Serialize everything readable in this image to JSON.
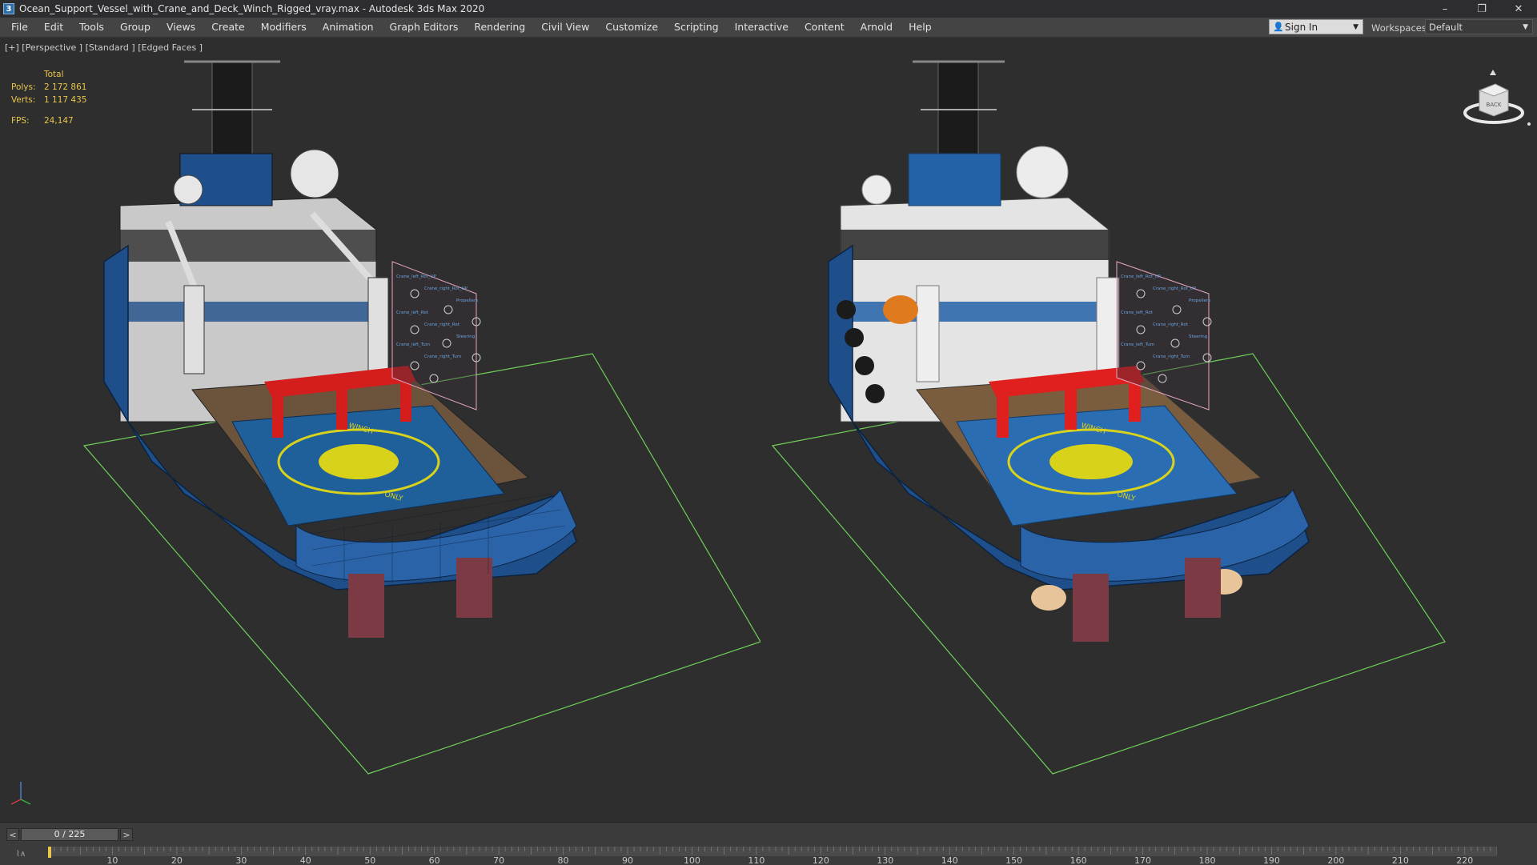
{
  "window": {
    "icon_letter": "3",
    "title": "Ocean_Support_Vessel_with_Crane_and_Deck_Winch_Rigged_vray.max - Autodesk 3ds Max 2020",
    "minimize": "–",
    "restore": "❐",
    "close": "✕"
  },
  "menu": {
    "items": [
      {
        "label": "File"
      },
      {
        "label": "Edit"
      },
      {
        "label": "Tools"
      },
      {
        "label": "Group"
      },
      {
        "label": "Views"
      },
      {
        "label": "Create"
      },
      {
        "label": "Modifiers"
      },
      {
        "label": "Animation"
      },
      {
        "label": "Graph Editors"
      },
      {
        "label": "Rendering"
      },
      {
        "label": "Civil View"
      },
      {
        "label": "Customize"
      },
      {
        "label": "Scripting"
      },
      {
        "label": "Interactive"
      },
      {
        "label": "Content"
      },
      {
        "label": "Arnold"
      },
      {
        "label": "Help"
      }
    ]
  },
  "account": {
    "signin_label": "Sign In"
  },
  "workspaces": {
    "label": "Workspaces:",
    "value": "Default"
  },
  "viewport": {
    "label": "[+] [Perspective ] [Standard ] [Edged Faces ]",
    "stats": {
      "total_label": "Total",
      "polys_label": "Polys:",
      "polys_value": "2 172 861",
      "verts_label": "Verts:",
      "verts_value": "1 117 435",
      "fps_label": "FPS:",
      "fps_value": "24,147"
    },
    "viewcube_face": "BACK",
    "panel_labels": {
      "a": "Crane_left_Rot_UP",
      "b": "Crane_right_Rot_UP",
      "c": "Propellers",
      "d": "Crane_left_Rot",
      "e": "Crane_right_Rot",
      "f": "Steering",
      "g": "Crane_left_Turn",
      "h": "Crane_right_Turn"
    },
    "deck_text_top": "WINCH",
    "deck_text_bottom": "ONLY"
  },
  "timeline": {
    "frame_display": "0 / 225",
    "prev": "<",
    "next": ">",
    "ticks": [
      "10",
      "20",
      "30",
      "40",
      "50",
      "60",
      "70",
      "80",
      "90",
      "100",
      "110",
      "120",
      "130",
      "140",
      "150",
      "160",
      "170",
      "180",
      "190",
      "200",
      "210",
      "220"
    ]
  },
  "colors": {
    "hull_blue": "#1f4f8a",
    "deck_red": "#d41d1d",
    "helipad_yellow": "#d8d31a",
    "grid_green": "#6fcf5a",
    "stats_yellow": "#e8c64a"
  }
}
